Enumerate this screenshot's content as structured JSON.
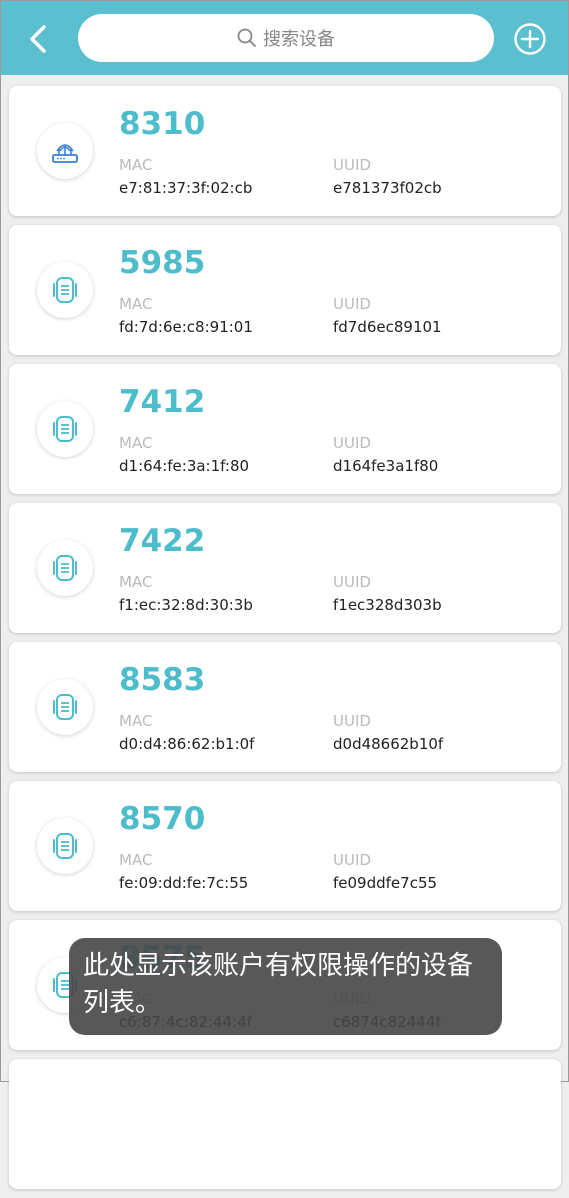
{
  "header": {
    "search_placeholder": "搜索设备"
  },
  "colors": {
    "accent": "#5bbfcf",
    "device_name": "#4dbccb"
  },
  "labels": {
    "mac": "MAC",
    "uuid": "UUID"
  },
  "devices": [
    {
      "name": "8310",
      "mac": "e7:81:37:3f:02:cb",
      "uuid": "e781373f02cb",
      "icon": "router-icon"
    },
    {
      "name": "5985",
      "mac": "fd:7d:6e:c8:91:01",
      "uuid": "fd7d6ec89101",
      "icon": "device-icon"
    },
    {
      "name": "7412",
      "mac": "d1:64:fe:3a:1f:80",
      "uuid": "d164fe3a1f80",
      "icon": "device-icon"
    },
    {
      "name": "7422",
      "mac": "f1:ec:32:8d:30:3b",
      "uuid": "f1ec328d303b",
      "icon": "device-icon"
    },
    {
      "name": "8583",
      "mac": "d0:d4:86:62:b1:0f",
      "uuid": "d0d48662b10f",
      "icon": "device-icon"
    },
    {
      "name": "8570",
      "mac": "fe:09:dd:fe:7c:55",
      "uuid": "fe09ddfe7c55",
      "icon": "device-icon"
    },
    {
      "name": "8575",
      "mac": "c6:87:4c:82:44:4f",
      "uuid": "c6874c82444f",
      "icon": "device-icon"
    }
  ],
  "toast": {
    "text": "此处显示该账户有权限操作的设备列表。"
  }
}
